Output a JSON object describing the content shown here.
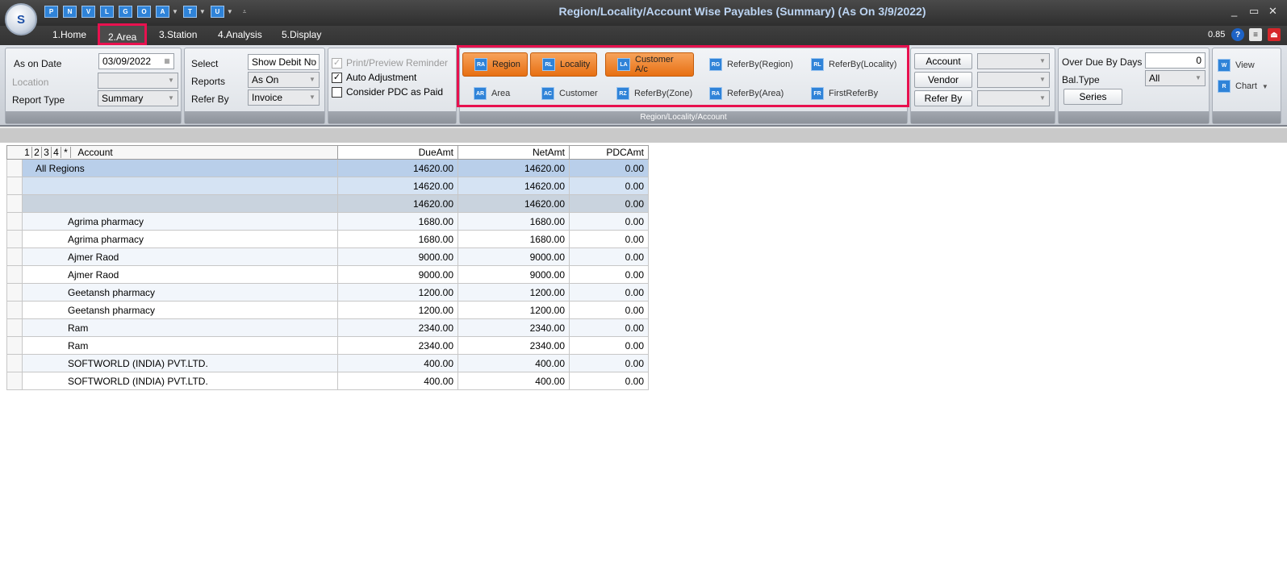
{
  "window": {
    "title": "Region/Locality/Account Wise Payables (Summary) (As On 3/9/2022)",
    "logo_text": "S",
    "controls": [
      "_",
      "▭",
      "✕"
    ]
  },
  "quick_access": [
    "P",
    "N",
    "V",
    "L",
    "G",
    "O",
    "A",
    "T",
    "U"
  ],
  "menu": {
    "items": [
      "1.Home",
      "2.Area",
      "3.Station",
      "4.Analysis",
      "5.Display"
    ],
    "zoom": "0.85"
  },
  "ribbon": {
    "filters": {
      "as_on_date_label": "As on Date",
      "as_on_date_value": "03/09/2022",
      "location_label": "Location",
      "location_value": "",
      "report_type_label": "Report Type",
      "report_type_value": "Summary"
    },
    "options": {
      "select_label": "Select",
      "select_value": "Show Debit No",
      "reports_label": "Reports",
      "reports_value": "As On",
      "refer_by_label": "Refer By",
      "refer_by_value": "Invoice"
    },
    "checks": {
      "print_preview": "Print/Preview Reminder",
      "auto_adjustment": "Auto Adjustment",
      "pdc_paid": "Consider PDC as Paid"
    },
    "group_buttons": {
      "footer": "Region/Locality/Account",
      "row1": [
        "Region",
        "Locality",
        "Customer A/c",
        "ReferBy(Region)",
        "ReferBy(Locality)"
      ],
      "row2": [
        "Area",
        "Customer",
        "ReferBy(Zone)",
        "ReferBy(Area)",
        "FirstReferBy"
      ]
    },
    "account_group": {
      "account": "Account",
      "vendor": "Vendor",
      "refer_by": "Refer By"
    },
    "due_group": {
      "over_due_label": "Over Due By Days",
      "over_due_value": "0",
      "bal_type_label": "Bal.Type",
      "bal_type_value": "All",
      "series": "Series"
    },
    "view_group": {
      "view": "View",
      "chart": "Chart"
    }
  },
  "grid": {
    "levels": [
      "1",
      "2",
      "3",
      "4",
      "*"
    ],
    "columns": [
      "Account",
      "DueAmt",
      "NetAmt",
      "PDCAmt"
    ],
    "rows": [
      {
        "account": "All Regions",
        "due": "14620.00",
        "net": "14620.00",
        "pdc": "0.00"
      },
      {
        "account": "",
        "due": "14620.00",
        "net": "14620.00",
        "pdc": "0.00"
      },
      {
        "account": "",
        "due": "14620.00",
        "net": "14620.00",
        "pdc": "0.00"
      },
      {
        "account": "Agrima pharmacy",
        "due": "1680.00",
        "net": "1680.00",
        "pdc": "0.00"
      },
      {
        "account": "Agrima pharmacy",
        "due": "1680.00",
        "net": "1680.00",
        "pdc": "0.00"
      },
      {
        "account": "Ajmer Raod",
        "due": "9000.00",
        "net": "9000.00",
        "pdc": "0.00"
      },
      {
        "account": "Ajmer Raod",
        "due": "9000.00",
        "net": "9000.00",
        "pdc": "0.00"
      },
      {
        "account": "Geetansh pharmacy",
        "due": "1200.00",
        "net": "1200.00",
        "pdc": "0.00"
      },
      {
        "account": "Geetansh pharmacy",
        "due": "1200.00",
        "net": "1200.00",
        "pdc": "0.00"
      },
      {
        "account": "Ram",
        "due": "2340.00",
        "net": "2340.00",
        "pdc": "0.00"
      },
      {
        "account": "Ram",
        "due": "2340.00",
        "net": "2340.00",
        "pdc": "0.00"
      },
      {
        "account": "SOFTWORLD (INDIA) PVT.LTD.",
        "due": "400.00",
        "net": "400.00",
        "pdc": "0.00"
      },
      {
        "account": "SOFTWORLD (INDIA) PVT.LTD.",
        "due": "400.00",
        "net": "400.00",
        "pdc": "0.00"
      }
    ]
  },
  "colors": {
    "highlight": "#e8114f",
    "active_button": "#e76f12",
    "title_text": "#bcd4f2"
  }
}
